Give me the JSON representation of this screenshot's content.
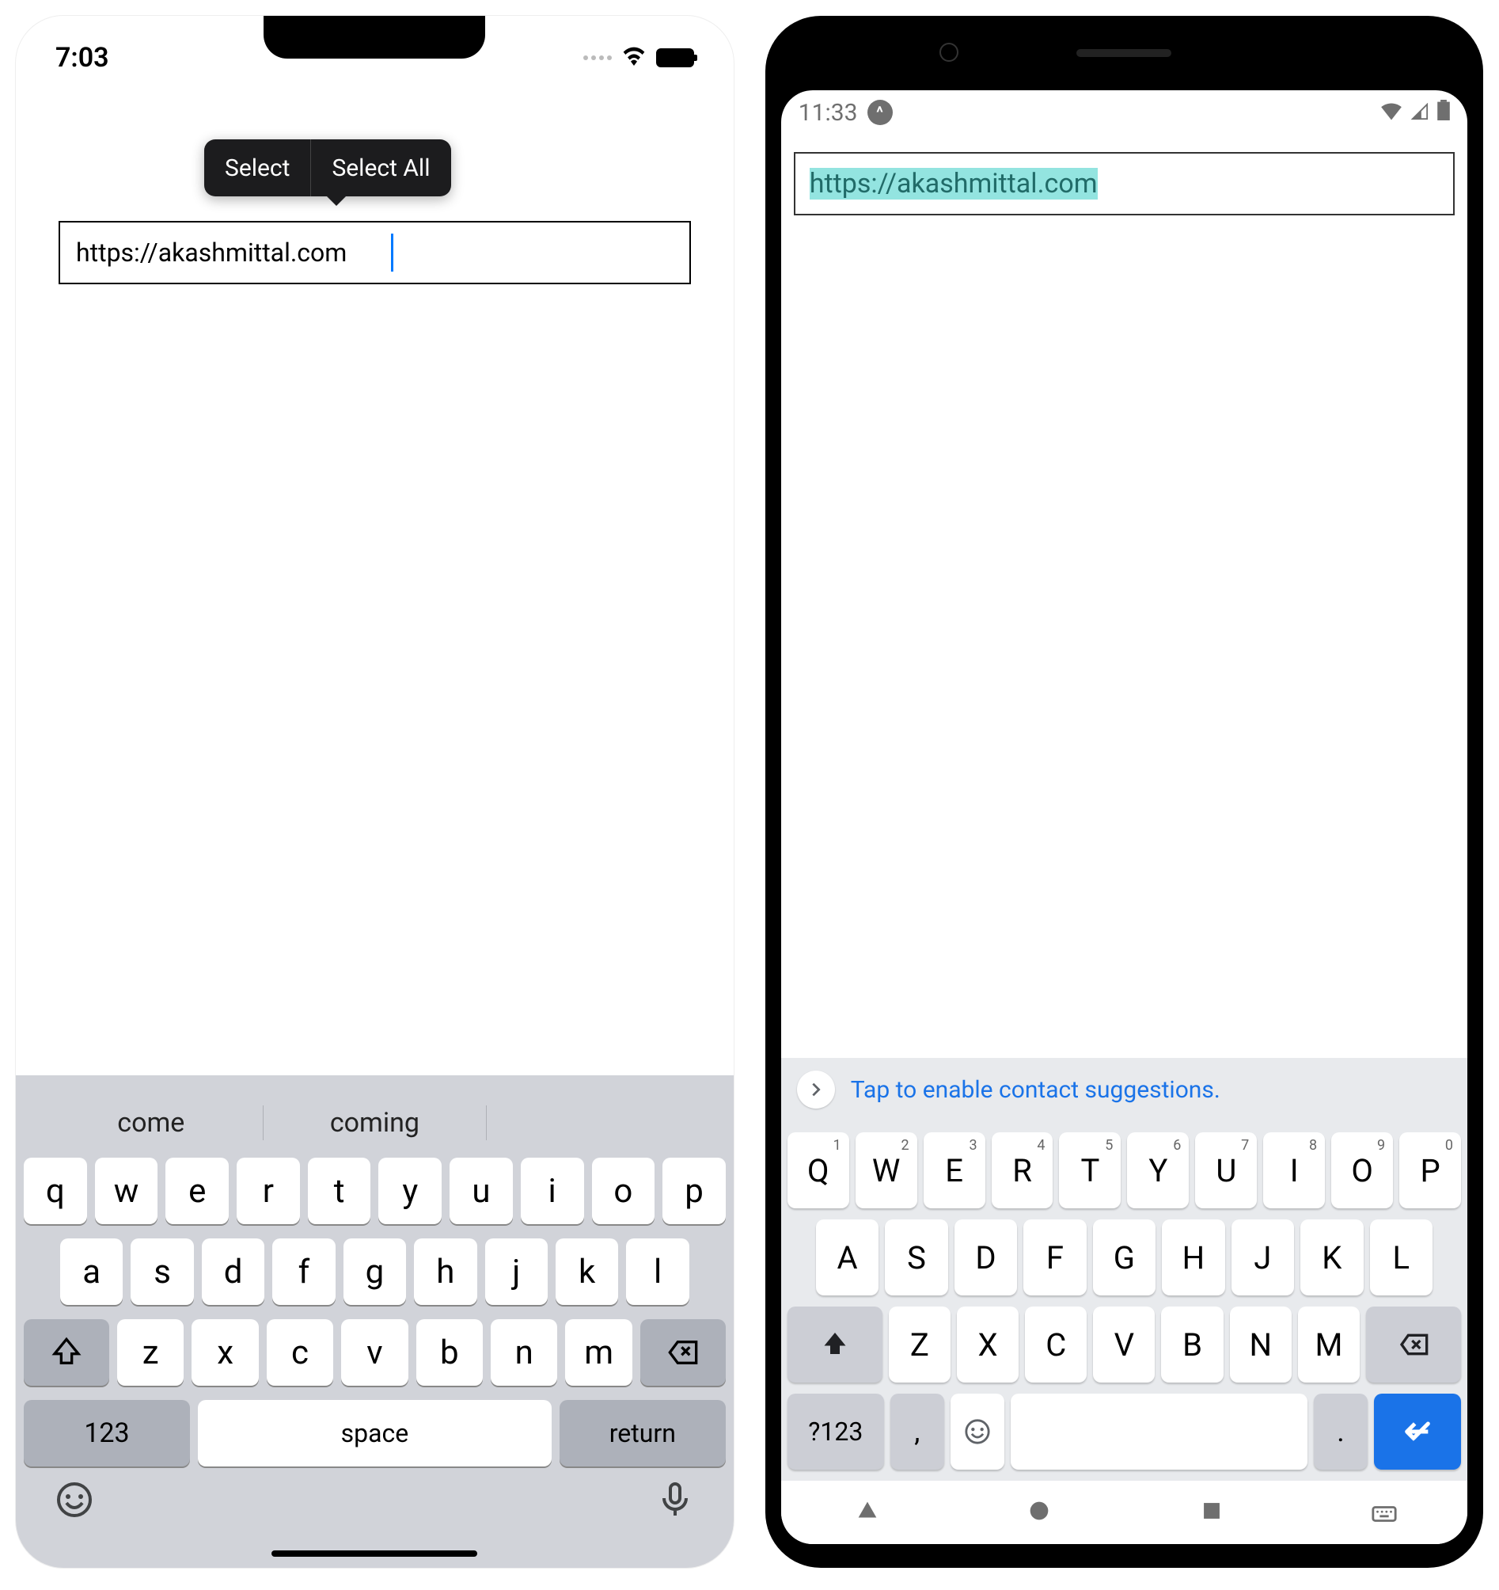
{
  "ios": {
    "statusbar": {
      "time": "7:03"
    },
    "context_menu": {
      "select": "Select",
      "select_all": "Select All"
    },
    "input": {
      "value": "https://akashmittal.com"
    },
    "suggestions": [
      "come",
      "coming"
    ],
    "keyboard": {
      "row1": [
        "q",
        "w",
        "e",
        "r",
        "t",
        "y",
        "u",
        "i",
        "o",
        "p"
      ],
      "row2": [
        "a",
        "s",
        "d",
        "f",
        "g",
        "h",
        "j",
        "k",
        "l"
      ],
      "row3": [
        "z",
        "x",
        "c",
        "v",
        "b",
        "n",
        "m"
      ],
      "numbers_label": "123",
      "space_label": "space",
      "return_label": "return"
    }
  },
  "android": {
    "statusbar": {
      "time": "11:33"
    },
    "input": {
      "value": "https://akashmittal.com"
    },
    "suggestion_hint": "Tap to enable contact suggestions.",
    "keyboard": {
      "row1": [
        {
          "k": "Q",
          "s": "1"
        },
        {
          "k": "W",
          "s": "2"
        },
        {
          "k": "E",
          "s": "3"
        },
        {
          "k": "R",
          "s": "4"
        },
        {
          "k": "T",
          "s": "5"
        },
        {
          "k": "Y",
          "s": "6"
        },
        {
          "k": "U",
          "s": "7"
        },
        {
          "k": "I",
          "s": "8"
        },
        {
          "k": "O",
          "s": "9"
        },
        {
          "k": "P",
          "s": "0"
        }
      ],
      "row2": [
        "A",
        "S",
        "D",
        "F",
        "G",
        "H",
        "J",
        "K",
        "L"
      ],
      "row3": [
        "Z",
        "X",
        "C",
        "V",
        "B",
        "N",
        "M"
      ],
      "numbers_label": "?123",
      "comma": ",",
      "period": "."
    }
  }
}
